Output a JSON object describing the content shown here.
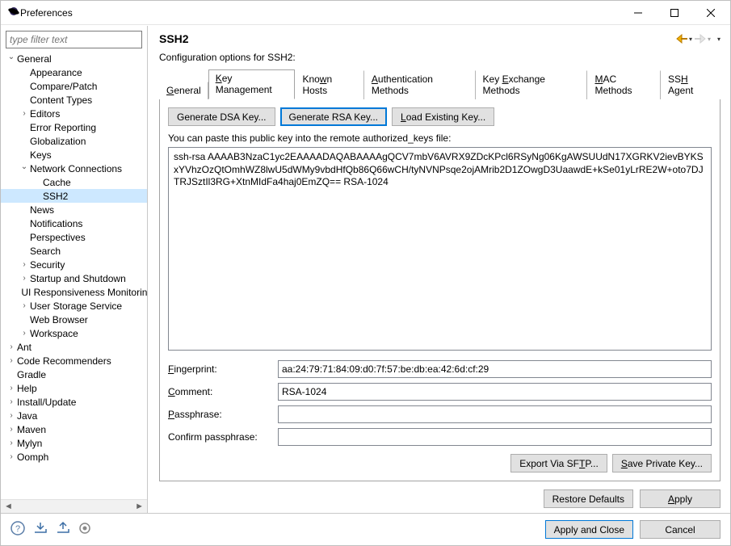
{
  "window": {
    "title": "Preferences"
  },
  "filter": {
    "placeholder": "type filter text"
  },
  "tree": [
    {
      "depth": 0,
      "exp": "open",
      "label": "General",
      "sel": false
    },
    {
      "depth": 1,
      "exp": "none",
      "label": "Appearance",
      "sel": false
    },
    {
      "depth": 1,
      "exp": "none",
      "label": "Compare/Patch",
      "sel": false
    },
    {
      "depth": 1,
      "exp": "none",
      "label": "Content Types",
      "sel": false
    },
    {
      "depth": 1,
      "exp": "closed",
      "label": "Editors",
      "sel": false
    },
    {
      "depth": 1,
      "exp": "none",
      "label": "Error Reporting",
      "sel": false
    },
    {
      "depth": 1,
      "exp": "none",
      "label": "Globalization",
      "sel": false
    },
    {
      "depth": 1,
      "exp": "none",
      "label": "Keys",
      "sel": false
    },
    {
      "depth": 1,
      "exp": "open",
      "label": "Network Connections",
      "sel": false
    },
    {
      "depth": 2,
      "exp": "none",
      "label": "Cache",
      "sel": false
    },
    {
      "depth": 2,
      "exp": "none",
      "label": "SSH2",
      "sel": true
    },
    {
      "depth": 1,
      "exp": "none",
      "label": "News",
      "sel": false
    },
    {
      "depth": 1,
      "exp": "none",
      "label": "Notifications",
      "sel": false
    },
    {
      "depth": 1,
      "exp": "none",
      "label": "Perspectives",
      "sel": false
    },
    {
      "depth": 1,
      "exp": "none",
      "label": "Search",
      "sel": false
    },
    {
      "depth": 1,
      "exp": "closed",
      "label": "Security",
      "sel": false
    },
    {
      "depth": 1,
      "exp": "closed",
      "label": "Startup and Shutdown",
      "sel": false
    },
    {
      "depth": 1,
      "exp": "none",
      "label": "UI Responsiveness Monitoring",
      "sel": false
    },
    {
      "depth": 1,
      "exp": "closed",
      "label": "User Storage Service",
      "sel": false
    },
    {
      "depth": 1,
      "exp": "none",
      "label": "Web Browser",
      "sel": false
    },
    {
      "depth": 1,
      "exp": "closed",
      "label": "Workspace",
      "sel": false
    },
    {
      "depth": 0,
      "exp": "closed",
      "label": "Ant",
      "sel": false
    },
    {
      "depth": 0,
      "exp": "closed",
      "label": "Code Recommenders",
      "sel": false
    },
    {
      "depth": 0,
      "exp": "none",
      "label": "Gradle",
      "sel": false
    },
    {
      "depth": 0,
      "exp": "closed",
      "label": "Help",
      "sel": false
    },
    {
      "depth": 0,
      "exp": "closed",
      "label": "Install/Update",
      "sel": false
    },
    {
      "depth": 0,
      "exp": "closed",
      "label": "Java",
      "sel": false
    },
    {
      "depth": 0,
      "exp": "closed",
      "label": "Maven",
      "sel": false
    },
    {
      "depth": 0,
      "exp": "closed",
      "label": "Mylyn",
      "sel": false
    },
    {
      "depth": 0,
      "exp": "closed",
      "label": "Oomph",
      "sel": false
    }
  ],
  "page": {
    "title": "SSH2",
    "subtitle": "Configuration options for SSH2:"
  },
  "tabs": [
    {
      "label": "General",
      "u": "G",
      "rest": "eneral"
    },
    {
      "label": "Key Management",
      "u": "K",
      "rest": "ey Management",
      "active": true
    },
    {
      "label": "Known Hosts",
      "pre": "Kno",
      "u": "w",
      "rest": "n Hosts"
    },
    {
      "label": "Authentication Methods",
      "u": "A",
      "rest": "uthentication Methods"
    },
    {
      "label": "Key Exchange Methods",
      "pre": "Key ",
      "u": "E",
      "rest": "xchange Methods"
    },
    {
      "label": "MAC Methods",
      "u": "M",
      "rest": "AC Methods"
    },
    {
      "label": "SSH Agent",
      "pre": "SS",
      "u": "H",
      "rest": " Agent"
    }
  ],
  "keymgmt": {
    "gen_dsa": "Generate DSA Key...",
    "gen_rsa": "Generate RSA Key...",
    "load_key_pre": "",
    "load_key_u": "L",
    "load_key_rest": "oad Existing Key...",
    "paste_line_pre": "",
    "paste_line_u": "Y",
    "paste_line_rest": "ou can paste this public key into the remote authorized_keys file:",
    "pubkey": "ssh-rsa AAAAB3NzaC1yc2EAAAADAQABAAAAgQCV7mbV6AVRX9ZDcKPcl6RSyNg06KgAWSUUdN17XGRKV2ievBYKSxYVhzOzQtOmhWZ8lwU5dWMy9vbdHfQb86Q66wCH/tyNVNPsqe2ojAMrib2D1ZOwgD3UaawdE+kSe01yLrRE2W+oto7DJTRJSztIl3RG+XtnMIdFa4haj0EmZQ== RSA-1024",
    "fingerprint_label_u": "F",
    "fingerprint_label_rest": "ingerprint:",
    "fingerprint": "aa:24:79:71:84:09:d0:7f:57:be:db:ea:42:6d:cf:29",
    "comment_label_u": "C",
    "comment_label_rest": "omment:",
    "comment": "RSA-1024",
    "pass_label_u": "P",
    "pass_label_rest": "assphrase:",
    "passphrase": "",
    "confirm_label": "Confirm passphrase:",
    "confirm": "",
    "export_pre": "Export Via SF",
    "export_u": "T",
    "export_rest": "P...",
    "save_u": "S",
    "save_rest": "ave Private Key..."
  },
  "actions": {
    "restore": "Restore Defaults",
    "apply_u": "A",
    "apply_rest": "pply",
    "apply_close": "Apply and Close",
    "cancel": "Cancel"
  }
}
